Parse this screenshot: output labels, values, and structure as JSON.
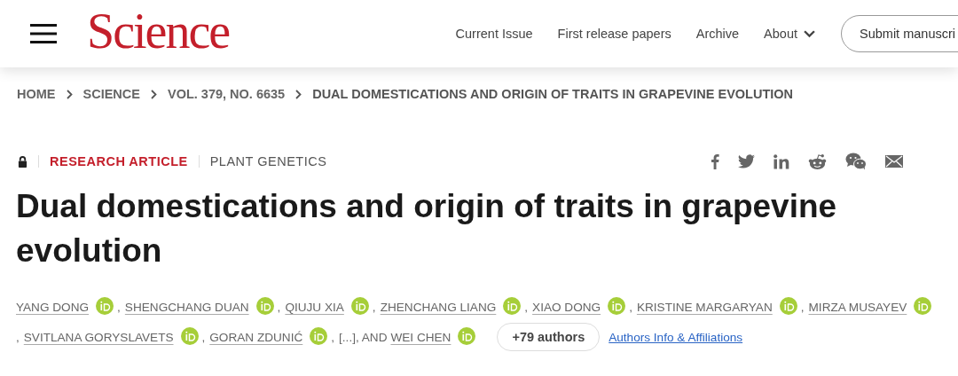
{
  "header": {
    "logo": "Science",
    "nav": [
      {
        "label": "Current Issue",
        "dropdown": false
      },
      {
        "label": "First release papers",
        "dropdown": false
      },
      {
        "label": "Archive",
        "dropdown": false
      },
      {
        "label": "About",
        "dropdown": true
      }
    ],
    "submit_button": "Submit manuscri"
  },
  "breadcrumb": [
    "HOME",
    "SCIENCE",
    "VOL. 379, NO. 6635",
    "DUAL DOMESTICATIONS AND ORIGIN OF TRAITS IN GRAPEVINE EVOLUTION"
  ],
  "article": {
    "locked": true,
    "type": "RESEARCH ARTICLE",
    "subject": "PLANT GENETICS",
    "share": [
      {
        "kind": "facebook"
      },
      {
        "kind": "twitter"
      },
      {
        "kind": "linkedin"
      },
      {
        "kind": "reddit"
      },
      {
        "kind": "wechat"
      },
      {
        "kind": "email"
      }
    ],
    "title": "Dual domestications and origin of traits in grapevine evolution",
    "authors": [
      {
        "name": "YANG DONG",
        "orcid": true
      },
      {
        "name": "SHENGCHANG DUAN",
        "orcid": true
      },
      {
        "name": "QIUJU XIA",
        "orcid": true
      },
      {
        "name": "ZHENCHANG LIANG",
        "orcid": true
      },
      {
        "name": "XIAO DONG",
        "orcid": true
      },
      {
        "name": "KRISTINE MARGARYAN",
        "orcid": true
      },
      {
        "name": "MIRZA MUSAYEV",
        "orcid": true
      },
      {
        "name": "SVITLANA GORYSLAVETS",
        "orcid": true
      },
      {
        "name": "GORAN ZDUNIĆ",
        "orcid": true
      }
    ],
    "separator": ",",
    "truncation": "[...], AND",
    "last_author": {
      "name": "WEI CHEN",
      "orcid": true
    },
    "more_authors_button": "+79 authors",
    "affiliations_link": "Authors Info & Affiliations"
  }
}
